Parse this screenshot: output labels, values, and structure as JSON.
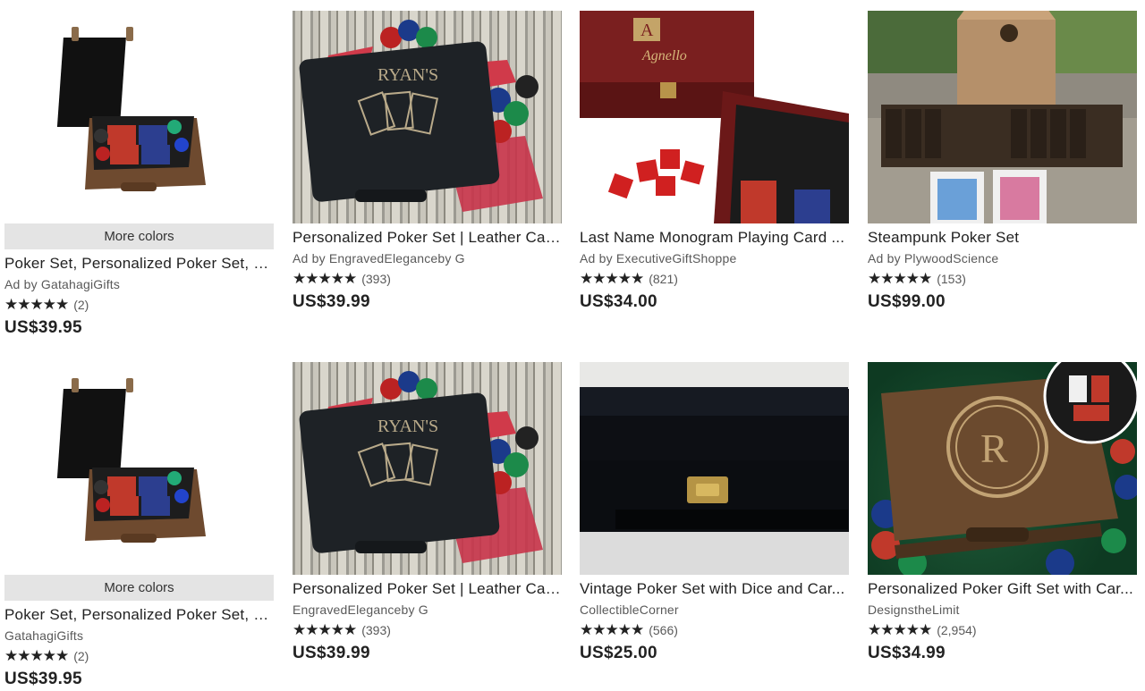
{
  "more_colors_label": "More colors",
  "listings": [
    {
      "more_colors": true,
      "title": "Poker Set, Personalized Poker Set, E...",
      "shop_line": "Ad by GatahagiGifts",
      "stars": "★★★★★",
      "reviews": "(2)",
      "price": "US$39.95"
    },
    {
      "more_colors": false,
      "title": "Personalized Poker Set | Leather Cas...",
      "shop_line": "Ad by EngravedEleganceby G",
      "stars": "★★★★★",
      "reviews": "(393)",
      "price": "US$39.99",
      "engraving": "RYAN'S"
    },
    {
      "more_colors": false,
      "title": "Last Name Monogram Playing Card ...",
      "shop_line": "Ad by ExecutiveGiftShoppe",
      "stars": "★★★★★",
      "reviews": "(821)",
      "price": "US$34.00",
      "engraving": "Agnello",
      "monogram": "A"
    },
    {
      "more_colors": false,
      "title": "Steampunk Poker Set",
      "shop_line": "Ad by PlywoodScience",
      "stars": "★★★★★",
      "reviews": "(153)",
      "price": "US$99.00"
    },
    {
      "more_colors": true,
      "title": "Poker Set, Personalized Poker Set, E...",
      "shop_line": "GatahagiGifts",
      "stars": "★★★★★",
      "reviews": "(2)",
      "price": "US$39.95"
    },
    {
      "more_colors": false,
      "title": "Personalized Poker Set | Leather Cas...",
      "shop_line": "EngravedEleganceby G",
      "stars": "★★★★★",
      "reviews": "(393)",
      "price": "US$39.99",
      "engraving": "RYAN'S"
    },
    {
      "more_colors": false,
      "title": "Vintage Poker Set with Dice and Car...",
      "shop_line": "CollectibleCorner",
      "stars": "★★★★★",
      "reviews": "(566)",
      "price": "US$25.00"
    },
    {
      "more_colors": false,
      "title": "Personalized Poker Gift Set with Car...",
      "shop_line": "DesignstheLimit",
      "stars": "★★★★★",
      "reviews": "(2,954)",
      "price": "US$34.99",
      "monogram": "R"
    }
  ]
}
